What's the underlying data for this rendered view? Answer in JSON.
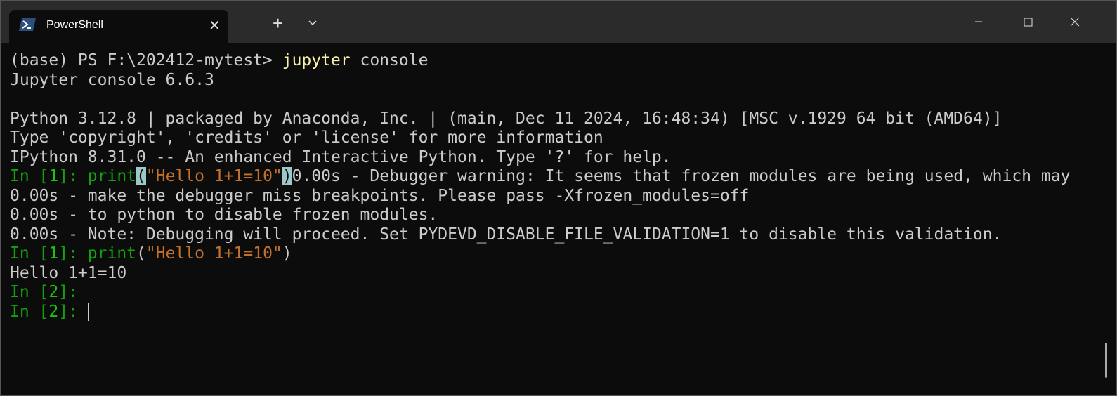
{
  "tab": {
    "title": "PowerShell",
    "close": "✕",
    "new": "+"
  },
  "lines": {
    "l1_prompt": "(base) PS F:\\202412-mytest> ",
    "l1_cmd": "jupyter",
    "l1_arg": " console",
    "l2": "Jupyter console 6.6.3",
    "l4": "Python 3.12.8 | packaged by Anaconda, Inc. | (main, Dec 11 2024, 16:48:34) [MSC v.1929 64 bit (AMD64)]",
    "l5": "Type 'copyright', 'credits' or 'license' for more information",
    "l6": "IPython 8.31.0 -- An enhanced Interactive Python. Type '?' for help.",
    "in": "In [",
    "n1": "1",
    "n2": "2",
    "close": "]: ",
    "print": "print",
    "lparen": "(",
    "rparen": ")",
    "str": "\"Hello 1+1=10\"",
    "l7_rest": "0.00s - Debugger warning: It seems that frozen modules are being used, which may",
    "l8": "0.00s - make the debugger miss breakpoints. Please pass -Xfrozen_modules=off",
    "l9": "0.00s - to python to disable frozen modules.",
    "l10": "0.00s - Note: Debugging will proceed. Set PYDEVD_DISABLE_FILE_VALIDATION=1 to disable this validation.",
    "l12": "Hello 1+1=10"
  }
}
